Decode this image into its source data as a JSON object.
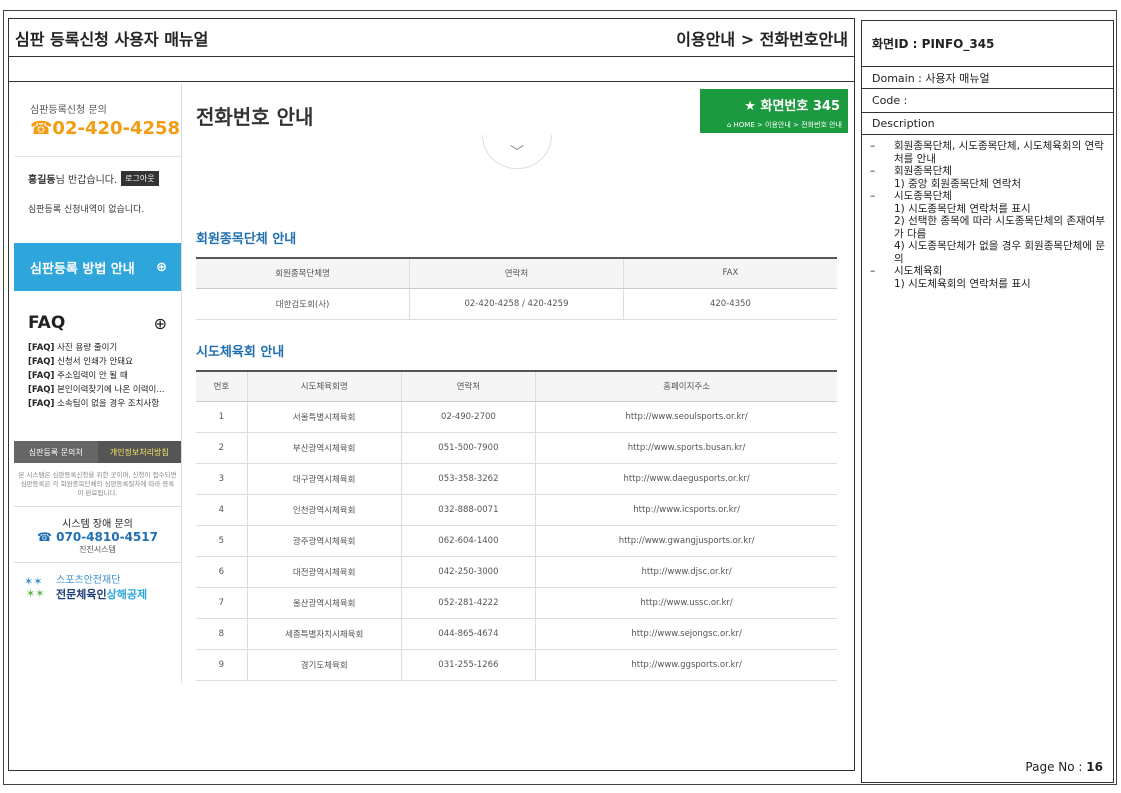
{
  "header": {
    "title": "심판 등록신청 사용자 매뉴얼",
    "path": "이용안내 > 전화번호안내"
  },
  "info": {
    "screen_id": "화면ID : PINFO_345",
    "domain": "Domain : 사용자 매뉴얼",
    "code": "Code :",
    "description_label": "Description",
    "description": [
      "회원종목단체, 시도종목단체, 시도체육회의 연락처를 안내",
      "회원종목단체\n1) 중앙 회원종목단체 연락처",
      "시도종목단체\n1) 시도종목단체 연락처를 표시\n2) 선택한 종목에 따라 시도종목단체의 존재여부가 다름\n4) 시도종목단체가 없을 경우 회원종목단체에 문의",
      "시도체육회\n1) 시도체육회의 연락처를 표시"
    ],
    "page_no_label": "Page No :",
    "page_no": "16"
  },
  "sidebar": {
    "contact_label": "심판등록신청 문의",
    "contact_phone": "02-420-4258",
    "user_name": "홍길동",
    "user_greet": "님 반갑습니다.",
    "logout": "로그아웃",
    "no_request": "심판등록 신청내역이 없습니다.",
    "guide": "심판등록 방법 안내",
    "faq_title": "FAQ",
    "faq_items": [
      {
        "tag": "[FAQ]",
        "text": "사진 용량 줄이기"
      },
      {
        "tag": "[FAQ]",
        "text": "신청서 인쇄가 안돼요"
      },
      {
        "tag": "[FAQ]",
        "text": "주소입력이 안 될 때"
      },
      {
        "tag": "[FAQ]",
        "text": "본인이력찾기에 나온 이력이..."
      },
      {
        "tag": "[FAQ]",
        "text": "소속팀이 없을 경우 조치사항"
      }
    ],
    "tab_contact": "심판등록 문의처",
    "tab_privacy": "개인정보처리방침",
    "notice": "본 시스템은 심판등록신청을 위한 곳이며, 신청이 접수되면 심판등록은 각 회원종목단체의 심판등록절차에 따라 등록이 완료됩니다.",
    "sys_label": "시스템 장애 문의",
    "sys_phone": "070-4810-4517",
    "sys_company": "진진시스템",
    "logo_line1": "스포츠안전재단",
    "logo_line2a": "전문체육인",
    "logo_line2b": "상해공제"
  },
  "content": {
    "title": "전화번호 안내",
    "screen_no": "화면번호 345",
    "breadcrumb": "HOME > 이용안내 > 전화번호 안내",
    "sec1_title": "회원종목단체 안내",
    "sec1_headers": [
      "회원종목단체명",
      "연락처",
      "FAX"
    ],
    "sec1_rows": [
      [
        "대한검도회(사)",
        "02-420-4258 / 420-4259",
        "420-4350"
      ]
    ],
    "sec2_title": "시도체육회 안내",
    "sec2_headers": [
      "번호",
      "시도체육회명",
      "연락처",
      "홈페이지주소"
    ],
    "sec2_rows": [
      [
        "1",
        "서울특별시체육회",
        "02-490-2700",
        "http://www.seoulsports.or.kr/"
      ],
      [
        "2",
        "부산광역시체육회",
        "051-500-7900",
        "http://www.sports.busan.kr/"
      ],
      [
        "3",
        "대구광역시체육회",
        "053-358-3262",
        "http://www.daegusports.or.kr/"
      ],
      [
        "4",
        "인천광역시체육회",
        "032-888-0071",
        "http://www.icsports.or.kr/"
      ],
      [
        "5",
        "광주광역시체육회",
        "062-604-1400",
        "http://www.gwangjusports.or.kr/"
      ],
      [
        "6",
        "대전광역시체육회",
        "042-250-3000",
        "http://www.djsc.or.kr/"
      ],
      [
        "7",
        "울산광역시체육회",
        "052-281-4222",
        "http://www.ussc.or.kr/"
      ],
      [
        "8",
        "세종특별자치시체육회",
        "044-865-4674",
        "http://www.sejongsc.or.kr/"
      ],
      [
        "9",
        "경기도체육회",
        "031-255-1266",
        "http://www.ggsports.or.kr/"
      ]
    ]
  }
}
